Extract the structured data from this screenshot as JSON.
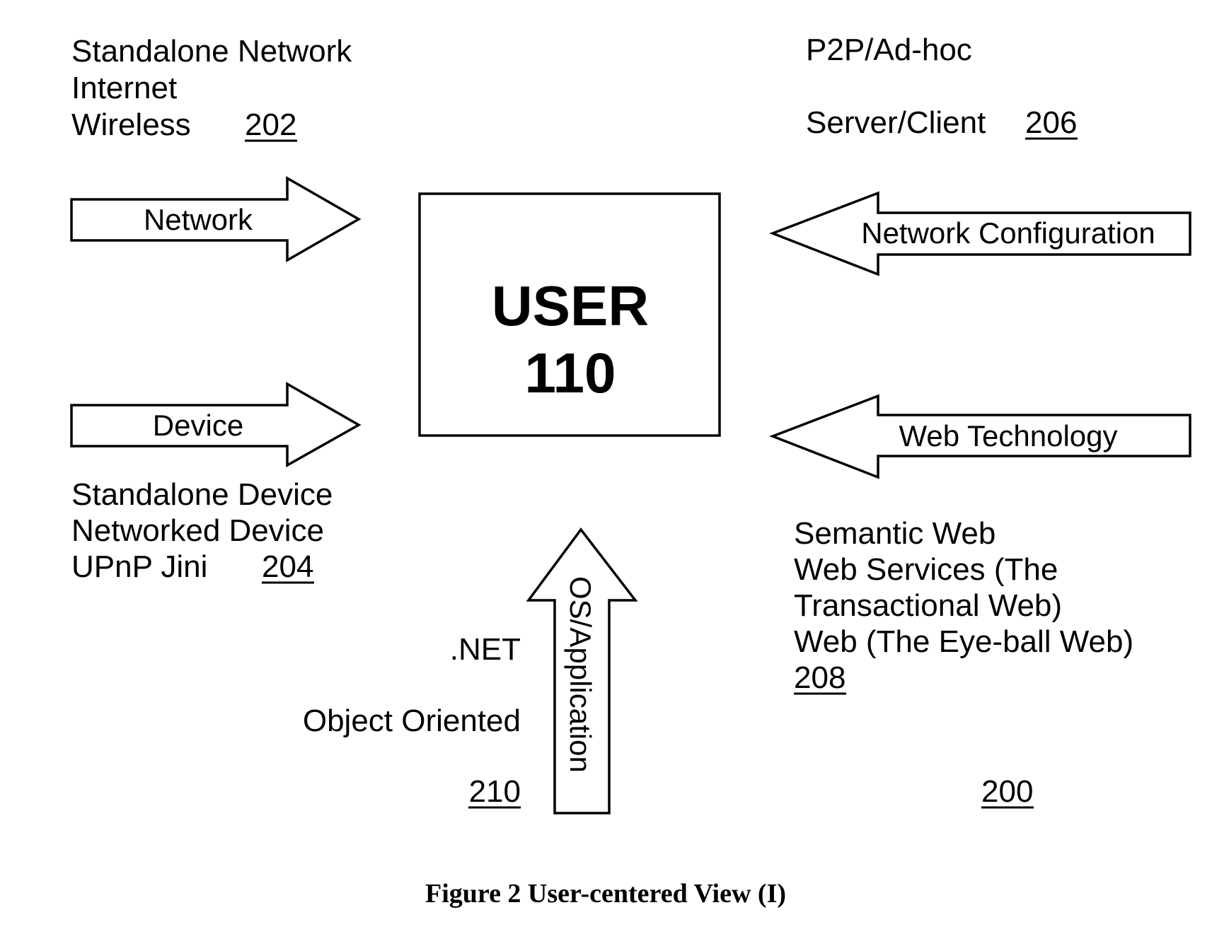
{
  "figure": {
    "caption": "Figure 2 User-centered View (I)",
    "reference_number": "200",
    "colors": {
      "ink": "#000000",
      "background": "#ffffff"
    }
  },
  "center": {
    "title": "USER",
    "number": "110"
  },
  "arrows": {
    "network": {
      "label": "Network",
      "direction": "right"
    },
    "device": {
      "label": "Device",
      "direction": "right"
    },
    "network_configuration": {
      "label": "Network Configuration",
      "direction": "left"
    },
    "web_technology": {
      "label": "Web Technology",
      "direction": "left"
    },
    "os_application": {
      "label": "OS/Application",
      "direction": "up"
    }
  },
  "groups": {
    "network_group": {
      "lines": [
        "Standalone Network",
        "Internet",
        "Wireless"
      ],
      "ref": "202"
    },
    "device_group": {
      "lines": [
        "Standalone Device",
        "Networked Device",
        "UPnP Jini"
      ],
      "ref": "204"
    },
    "config_group": {
      "lines": [
        "P2P/Ad-hoc",
        "Server/Client"
      ],
      "ref": "206"
    },
    "web_group": {
      "lines": [
        "Semantic Web",
        "Web Services (The",
        "Transactional Web)",
        "Web (The Eye-ball Web)"
      ],
      "ref": "208"
    },
    "os_group": {
      "lines": [
        ".NET",
        "Object Oriented"
      ],
      "ref": "210"
    }
  }
}
